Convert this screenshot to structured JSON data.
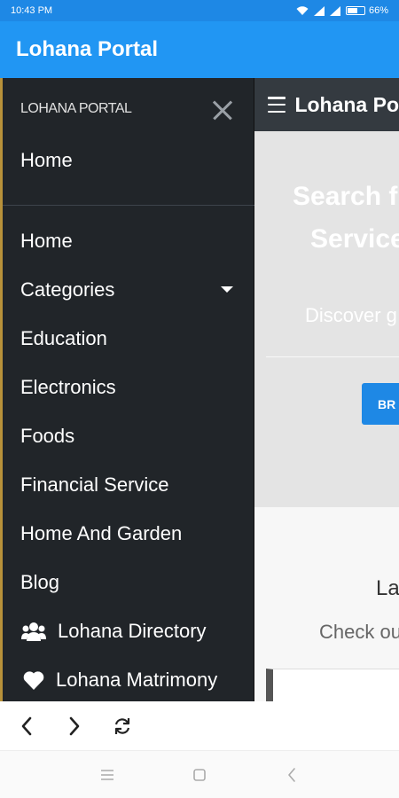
{
  "status_bar": {
    "time": "10:43 PM",
    "battery_percent": "66%",
    "battery_level": 0.66,
    "icons": [
      "wifi-icon",
      "signal-icon",
      "signal-icon",
      "battery-icon"
    ]
  },
  "app_bar": {
    "title": "Lohana Portal",
    "color": "#2196f3"
  },
  "page": {
    "nav_brand": "Lohana Po",
    "hero": {
      "title_lines": [
        "Search f",
        "Service"
      ],
      "subtitle": "Discover g",
      "button_label": "BR"
    },
    "section": {
      "title": "La",
      "subtitle": "Check ou"
    }
  },
  "drawer": {
    "brand": "LOHANA PORTAL",
    "close_icon": "close-icon",
    "home_top": "Home",
    "items": [
      {
        "label": "Home"
      },
      {
        "label": "Categories",
        "icon": "caret-down-icon"
      },
      {
        "label": "Education"
      },
      {
        "label": "Electronics"
      },
      {
        "label": "Foods"
      },
      {
        "label": "Financial Service"
      },
      {
        "label": "Home And Garden"
      },
      {
        "label": "Blog"
      },
      {
        "label": "Lohana Directory",
        "icon": "users-icon"
      },
      {
        "label": "Lohana Matrimony",
        "icon": "heart-icon"
      }
    ],
    "background": "#212529",
    "accent": "#b8913a"
  },
  "browser_toolbar": {
    "buttons": [
      "back-icon",
      "forward-icon",
      "refresh-icon"
    ]
  },
  "system_nav": {
    "buttons": [
      "menu-icon",
      "home-icon",
      "back-icon"
    ]
  }
}
